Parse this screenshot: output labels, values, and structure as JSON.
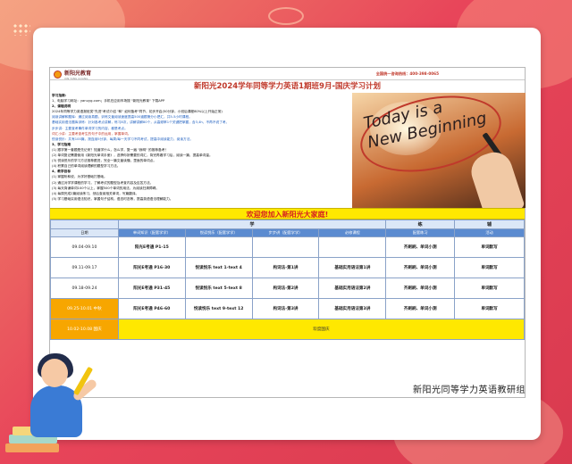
{
  "header": {
    "logo_name": "新阳光教育",
    "logo_sub": "XIN YANG GUANG",
    "hotline": "全国统一咨询热线：400-398-0065"
  },
  "title": "新阳光2024学年同等学力英语1期班9月-国庆学习计划",
  "intro_lines": [
    {
      "text": "学习指南：",
      "style": "hd"
    },
    {
      "text": "1、电脑学习网址：yanuyg.com；手机在应用市场搜 \"新阳光教育\" 下载APP",
      "style": ""
    },
    {
      "text": "2、课程说明",
      "style": "hd"
    },
    {
      "text": "   2024年同等学力英语报班类\"先进\"考试介绍 \"和\" 如何备考\"同节，初步开启(50分钟，小班后课程80%以上开始正常)",
      "style": ""
    },
    {
      "text": "   阅读讲解和题库：通过阅读真题，训练文章阅读速度提高500道题第分小把汇，共5-5小时课程。",
      "style": "blue"
    },
    {
      "text": "   基础实用语法题库训练：针对各考点讲解，练习8次，讲解讲解80个，从高频率1个关键把掌握，含3,4h，不再不说了考。",
      "style": "blue"
    },
    {
      "text": "   步步讲：主要查考事件单词学习的内容，都是考点。",
      "style": "blue"
    },
    {
      "text": "   词汇小讲：主要考查考生的句子中的运用，掌握单词。",
      "style": "red"
    },
    {
      "text": "   悦读悦乐：共有100篇，按连续5分钟，每周/每一天学习不同考试，提高中阅读能力，阅读方法。",
      "style": "blue"
    },
    {
      "text": "3、学习指南",
      "style": "hd"
    },
    {
      "text": "(1) 跟学第一套题是先记来？知道学什么，怎么学，复一遍 \"我明\" 的推荐备考！",
      "style": ""
    },
    {
      "text": "(2) 单词复记需要使用《新阳光单词手册》，选择你所需要的词汇，背完再看学习后，阅读一篇，提高单词量。",
      "style": ""
    },
    {
      "text": "(3) 悦读悦乐的学习方法推荐跟进，完全一篇文章读懂，里面的单词点。",
      "style": ""
    },
    {
      "text": "(4) 积累自己的单词阅读理解的题型学习方法。",
      "style": ""
    },
    {
      "text": "4、教学目标",
      "style": "hd"
    },
    {
      "text": "(1) 掌握听和说，为学好基础打基础。",
      "style": ""
    },
    {
      "text": "(2) 通过对学学课程的学习，了解考试的题型及考查内容及应答方法。",
      "style": ""
    },
    {
      "text": "(3) 每天背诵单词100个以上，掌握500个单词的用法，为阅读扫清障碍。",
      "style": ""
    },
    {
      "text": "(4) 每周完成2篇阅读练习，然后查阅相关单词，写篇翻译。",
      "style": ""
    },
    {
      "text": "(5) 学习基础实用语法知识，掌握句子结构，语态时态等，提高英语语法理解能力。",
      "style": ""
    }
  ],
  "photo": {
    "text_line1": "Today is a",
    "text_line2": "New Beginning"
  },
  "welcome": "欢迎您加入新阳光大家庭!",
  "table": {
    "group_headers": [
      "学",
      "练",
      "辅"
    ],
    "sub_headers": [
      "日期",
      "单词知识（配套学学）",
      "悦读悦乐（配套学学）",
      "步步讲（配套学学）",
      "必修课程",
      "配套练习",
      "活动"
    ],
    "rows": [
      {
        "date": "09.04-09.10",
        "cells": [
          "阳光E考通 P1-15",
          "",
          "",
          "",
          "齐刷刷、单词小测",
          "单词默写"
        ]
      },
      {
        "date": "09.11-09.17",
        "cells": [
          "阳光E考通 P16-30",
          "悦读悦乐 text 1-text 4",
          "构词法-第1讲",
          "基础实用语法第1讲",
          "齐刷刷、单词小测",
          "单词默写"
        ]
      },
      {
        "date": "09.18-09.24",
        "cells": [
          "阳光E考通 P31-45",
          "悦读悦乐 text 5-text 8",
          "构词法-第2讲",
          "基础实用语法第2讲",
          "齐刷刷、单词小测",
          "单词默写"
        ]
      },
      {
        "date": "09.25-10.01 中秋",
        "cells": [
          "阳光E考通 P46-60",
          "悦读悦乐 text 9-text 12",
          "构词法-第3讲",
          "基础实用语法第3讲",
          "齐刷刷、单词小测",
          "单词默写"
        ]
      }
    ],
    "holiday_row": {
      "date": "10.02-10.08 国庆",
      "note": "欢度国庆"
    }
  },
  "footer": "新阳光同等学力英语教研组",
  "colors": {
    "accent_red": "#c0392b",
    "welcome_yellow": "#ffe800",
    "header_blue": "#5b8bd0",
    "date_orange": "#f7a600"
  }
}
